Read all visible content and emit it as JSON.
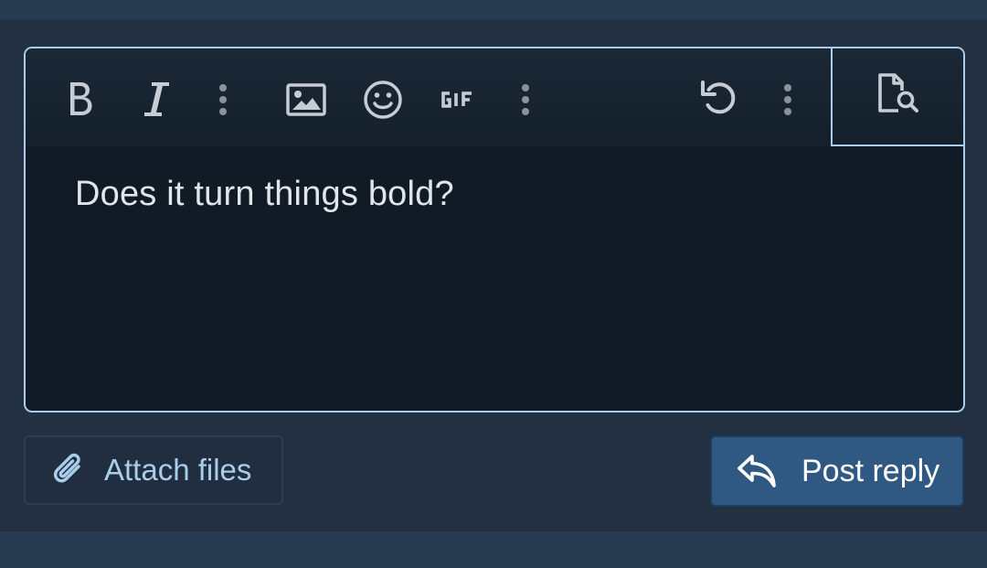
{
  "toolbar": {
    "buttons": [
      {
        "name": "bold",
        "icon": "bold-icon"
      },
      {
        "name": "italic",
        "icon": "italic-icon"
      },
      {
        "name": "more-text-options",
        "icon": "vertical-ellipsis-icon"
      },
      {
        "name": "insert-image",
        "icon": "image-icon"
      },
      {
        "name": "smilies",
        "icon": "smiley-icon"
      },
      {
        "name": "gif",
        "icon": "gif-icon",
        "label": "GIF"
      },
      {
        "name": "more-insert-options",
        "icon": "vertical-ellipsis-icon"
      },
      {
        "name": "undo",
        "icon": "undo-icon"
      },
      {
        "name": "more-options",
        "icon": "vertical-ellipsis-icon"
      }
    ],
    "preview_toggle": {
      "icon": "document-search-icon"
    }
  },
  "editor": {
    "content": "Does it turn things bold?"
  },
  "actions": {
    "attach_label": "Attach files",
    "attach_icon": "paperclip-icon",
    "post_label": "Post reply",
    "post_icon": "reply-arrow-icon"
  },
  "colors": {
    "page_background": "#263a50",
    "panel_background": "#223042",
    "editor_background": "#111b26",
    "editor_border": "#a9cdea",
    "icon_color": "#c6ccd3",
    "attach_text": "#a9cdea",
    "post_button_background": "#2f5983",
    "post_button_text": "#ffffff"
  }
}
